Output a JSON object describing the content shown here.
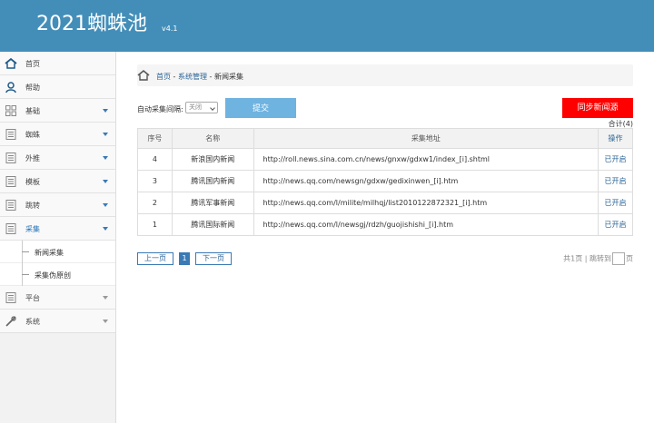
{
  "header": {
    "title": "2021蜘蛛池",
    "version": "v4.1"
  },
  "sidebar": {
    "items": [
      {
        "label": "首页",
        "icon": "home-icon",
        "caret": ""
      },
      {
        "label": "帮助",
        "icon": "user-icon",
        "caret": ""
      },
      {
        "label": "基础",
        "icon": "grid-icon",
        "caret": "blue"
      },
      {
        "label": "蜘蛛",
        "icon": "list-icon",
        "caret": "blue"
      },
      {
        "label": "外推",
        "icon": "list-icon",
        "caret": "blue"
      },
      {
        "label": "模板",
        "icon": "list-icon",
        "caret": "blue"
      },
      {
        "label": "跳转",
        "icon": "list-icon",
        "caret": "blue"
      },
      {
        "label": "采集",
        "icon": "list-icon",
        "caret": "blue"
      }
    ],
    "sub_items": [
      {
        "label": "新闻采集"
      },
      {
        "label": "采集伪原创"
      }
    ],
    "items_after": [
      {
        "label": "平台",
        "icon": "list-icon",
        "caret": "grey"
      },
      {
        "label": "系统",
        "icon": "tools-icon",
        "caret": "grey"
      }
    ]
  },
  "breadcrumb": {
    "home": "首页",
    "sep": " - ",
    "level2": "系统管理",
    "current": "新闻采集"
  },
  "toolbar": {
    "interval_label": "自动采集间隔:",
    "interval_value": "关闭",
    "submit_label": "提交",
    "sync_label": "同步新闻源",
    "total_label": "合计(4)"
  },
  "table": {
    "columns": [
      "序号",
      "名称",
      "采集地址",
      "操作"
    ],
    "rows": [
      [
        "4",
        "新浪国内新闻",
        "http://roll.news.sina.com.cn/news/gnxw/gdxw1/index_[i].shtml",
        "已开启"
      ],
      [
        "3",
        "腾讯国内新闻",
        "http://news.qq.com/newsgn/gdxw/gedixinwen_[i].htm",
        "已开启"
      ],
      [
        "2",
        "腾讯军事新闻",
        "http://news.qq.com/l/milite/milhqj/list2010122872321_[i].htm",
        "已开启"
      ],
      [
        "1",
        "腾讯国际新闻",
        "http://news.qq.com/l/newsgj/rdzh/guojishishi_[i].htm",
        "已开启"
      ]
    ]
  },
  "pager": {
    "prev": "上一页",
    "current": "1",
    "next": "下一页",
    "info_total": "共1页",
    "info_sep": "|",
    "info_jump": "跳转到",
    "info_page": "页"
  }
}
